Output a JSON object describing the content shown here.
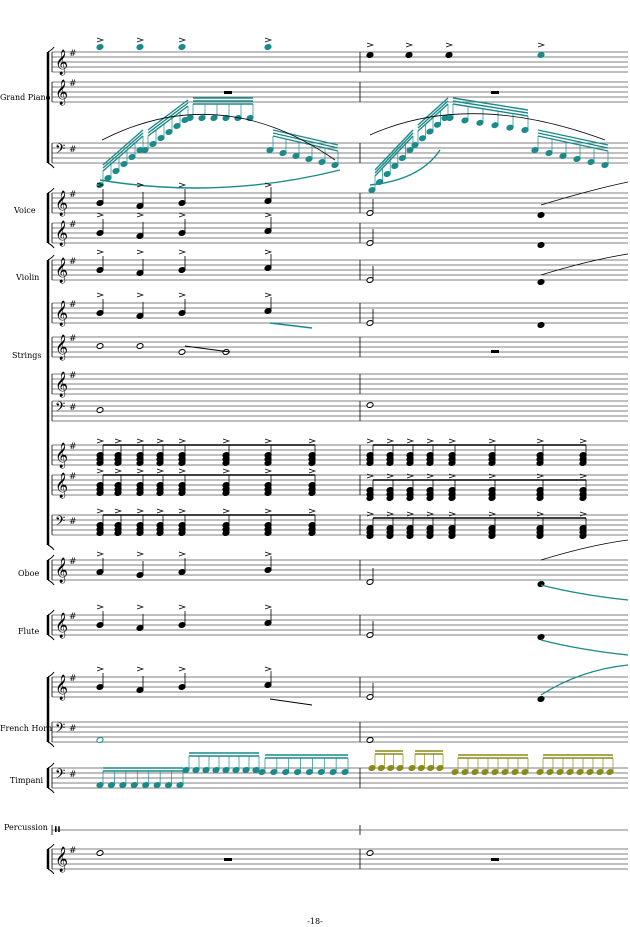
{
  "instruments": [
    {
      "name": "Grand Piano"
    },
    {
      "name": "Voice"
    },
    {
      "name": "Violin"
    },
    {
      "name": "Strings"
    },
    {
      "name": "Oboe"
    },
    {
      "name": "Flute"
    },
    {
      "name": "French Horn"
    },
    {
      "name": "Timpani"
    },
    {
      "name": "Percussion"
    }
  ],
  "page_number": "-18-",
  "colors": {
    "teal": "#1a8a8a",
    "olive": "#8a8a1a",
    "ink": "#000000"
  }
}
